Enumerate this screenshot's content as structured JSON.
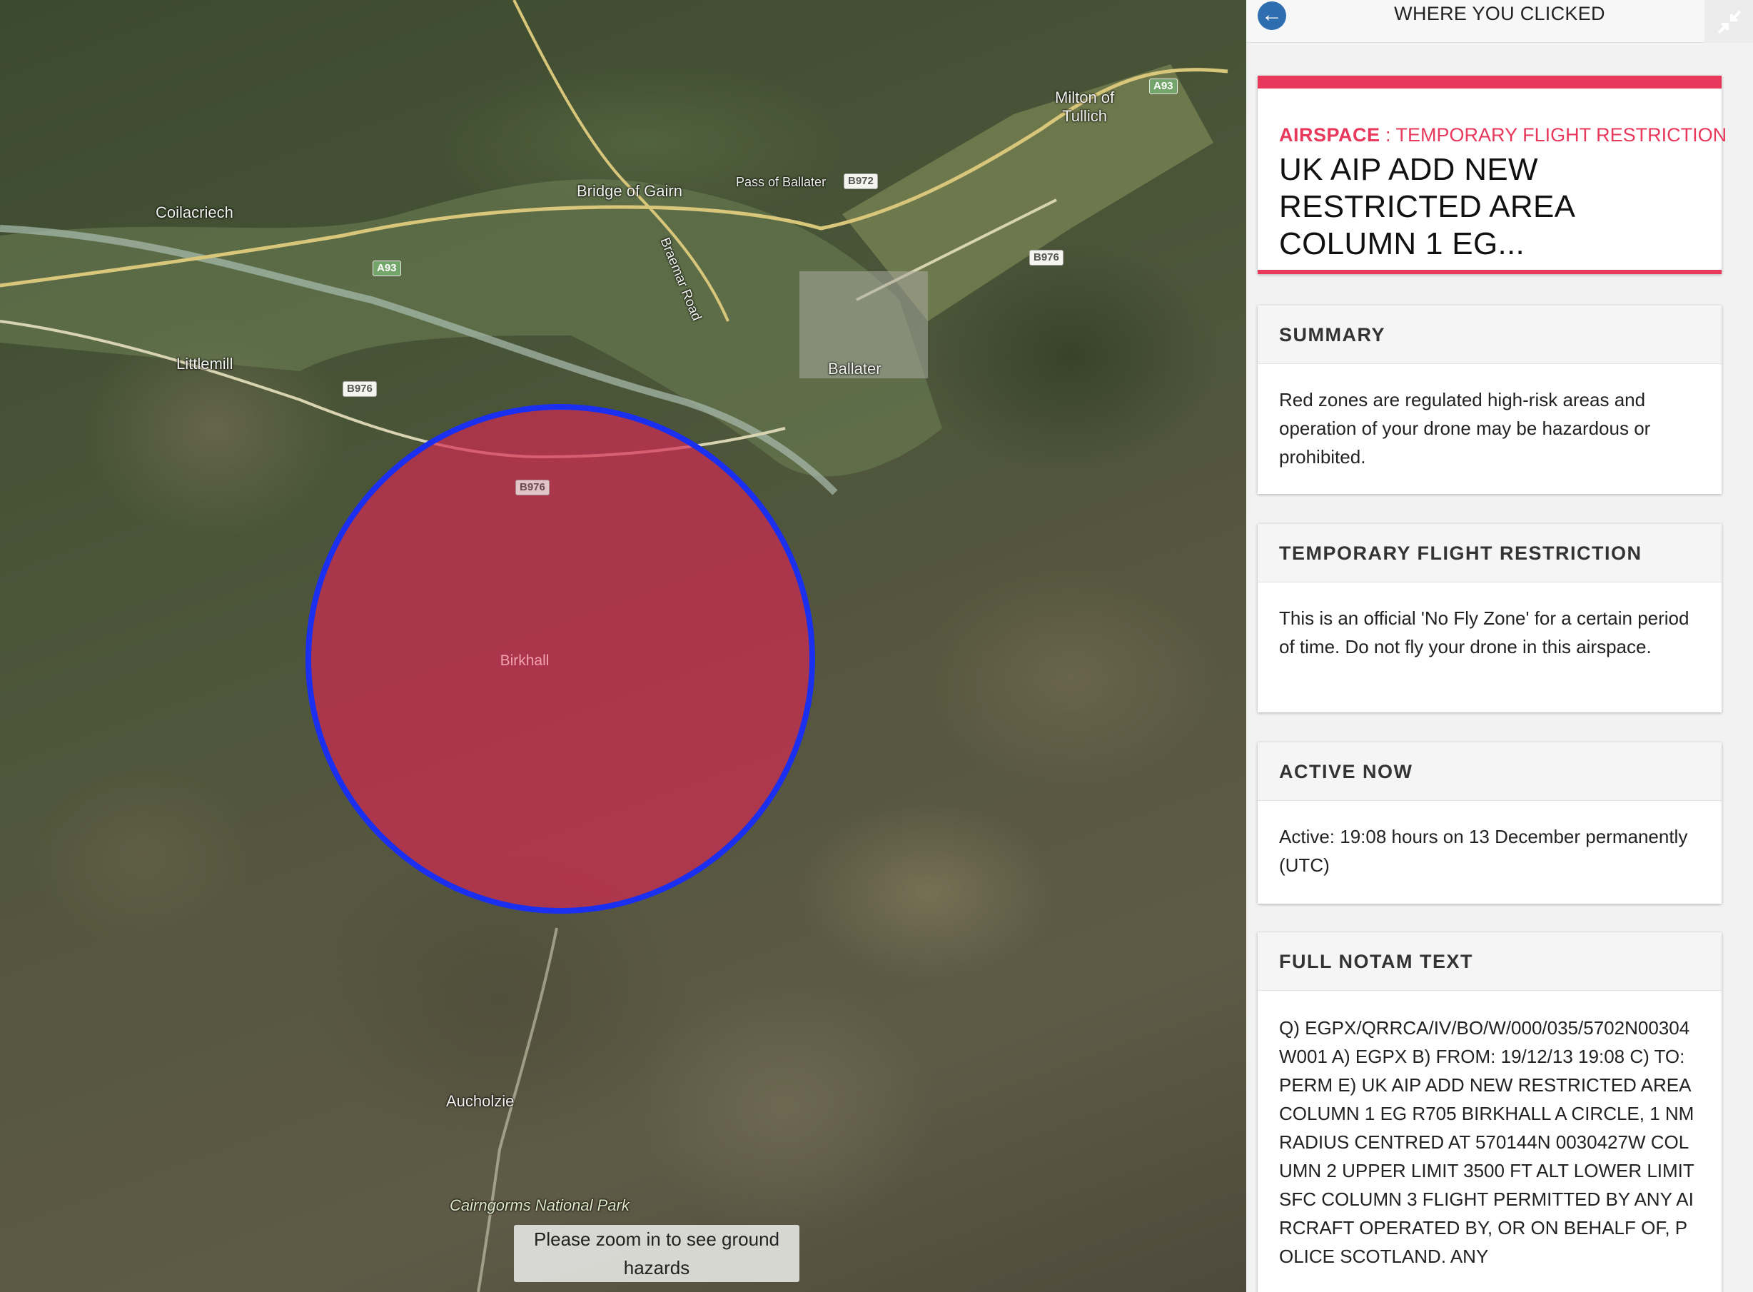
{
  "map": {
    "places": {
      "milton_of_tullich": "Milton of\nTullich",
      "bridge_of_gairn": "Bridge of Gairn",
      "pass_of_ballater": "Pass of Ballater",
      "coilacriech": "Coilacriech",
      "braemar_road": "Braemar Road",
      "littlemill": "Littlemill",
      "ballater": "Ballater",
      "birkhall": "Birkhall",
      "aucholzie": "Aucholzie",
      "cairngorms": "Cairngorms National Park"
    },
    "roads": {
      "a93_top": "A93",
      "b972": "B972",
      "a93_left": "A93",
      "b976_right": "B976",
      "b976_left": "B976",
      "b976_center": "B976"
    },
    "zone": {
      "fill_color": "#d62852",
      "border_color": "#1b2ff0"
    },
    "zoom_toast": "Please zoom in to see ground hazards"
  },
  "panel": {
    "back_icon": "arrow-left-circle-icon",
    "title": "WHERE YOU CLICKED",
    "collapse_icon": "collapse-arrows-icon",
    "accent_color": "#e8385c",
    "airspace_label": "AIRSPACE",
    "airspace_type": " : TEMPORARY FLIGHT RESTRICTION",
    "headline": "UK AIP ADD NEW RESTRICTED AREA COLUMN 1 EG...",
    "sections": {
      "summary": {
        "heading": "SUMMARY",
        "body": "Red zones are regulated high-risk areas and operation of your drone may be hazardous or prohibited."
      },
      "tfr": {
        "heading": "TEMPORARY FLIGHT RESTRICTION",
        "body": "This is an official 'No Fly Zone' for a certain period of time. Do not fly your drone in this airspace."
      },
      "active": {
        "heading": "ACTIVE NOW",
        "body": "Active: 19:08 hours on 13 December permanently (UTC)"
      },
      "notam": {
        "heading": "FULL NOTAM TEXT",
        "body": "Q) EGPX/QRRCA/IV/BO/W/000/035/5702N00304W001  A) EGPX B) FROM: 19/12/13 19:08 C) TO: PERM  E) UK AIP ADD NEW RESTRICTED AREA COLUMN 1 EG R705 BIRKHALL A CIRCLE, 1 NM RADIUS CENTRED AT 570144N 0030427W COLUMN 2 UPPER LIMIT 3500 FT ALT LOWER LIMIT SFC COLUMN 3 FLIGHT PERMITTED BY ANY AIRCRAFT OPERATED BY, OR ON BEHALF OF, POLICE SCOTLAND. ANY"
      }
    }
  }
}
